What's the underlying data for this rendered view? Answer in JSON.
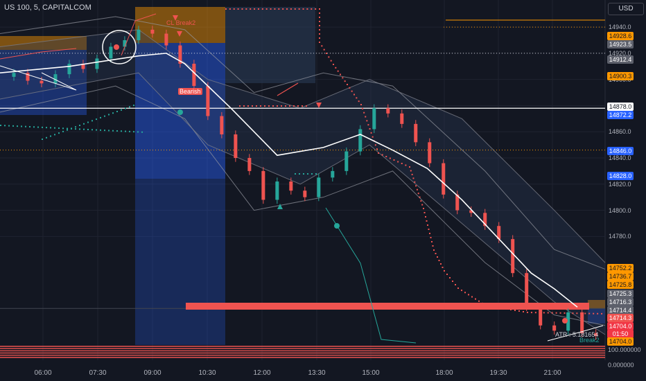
{
  "header": {
    "title": "US 100, 5, CAPITALCOM",
    "currency": "USD"
  },
  "colors": {
    "background": "#131722",
    "bull": "#26a69a",
    "bear": "#ef5350",
    "orange": "#ff9800",
    "blue": "#2962ff",
    "grey": "#b2b5be",
    "white": "#ffffff"
  },
  "chart_data": {
    "type": "candlestick",
    "symbol": "US 100, 5, CAPITALCOM",
    "currency": "USD",
    "x_ticks": [
      "06:00",
      "07:30",
      "09:00",
      "10:30",
      "12:00",
      "13:30",
      "15:00",
      "18:00",
      "19:30",
      "21:00"
    ],
    "y_ticks": [
      14940.0,
      14920.0,
      14900.0,
      14880.0,
      14860.0,
      14840.0,
      14820.0,
      14800.0,
      14780.0
    ],
    "y_range": [
      14696,
      14948
    ],
    "price_badges": [
      {
        "value": "14928.6",
        "kind": "orange"
      },
      {
        "value": "14923.5",
        "kind": "grey"
      },
      {
        "value": "14912.4",
        "kind": "grey"
      },
      {
        "value": "14900.3",
        "kind": "orange"
      },
      {
        "value": "14878.0",
        "kind": "white"
      },
      {
        "value": "14872.2",
        "kind": "blue"
      },
      {
        "value": "14846.0",
        "kind": "blue"
      },
      {
        "value": "14828.0",
        "kind": "blue"
      },
      {
        "value": "14752.2",
        "kind": "orange"
      },
      {
        "value": "14736.7",
        "kind": "orange"
      },
      {
        "value": "14725.8",
        "kind": "orange"
      },
      {
        "value": "14725.3",
        "kind": "grey"
      },
      {
        "value": "14716.3",
        "kind": "grey"
      },
      {
        "value": "14714.4",
        "kind": "grey"
      },
      {
        "value": "14714.3",
        "kind": "red"
      },
      {
        "value": "14704.0",
        "kind": "current"
      },
      {
        "value": "01:50",
        "kind": "current"
      },
      {
        "value": "14704.0",
        "kind": "orange"
      }
    ],
    "countdown": "01:50",
    "horizontal_levels": [
      14940.0,
      14920.0,
      14878.0,
      14846.0,
      14725.0
    ],
    "annotations": [
      "CL Break2",
      "Bearish",
      "ATR : 5.181654",
      "Break2"
    ],
    "atr_value": "ATR : 5.181654",
    "indicator_panel": {
      "ticks": [
        "100.000000",
        "0.000000"
      ]
    },
    "close_points": [
      [
        0,
        14902
      ],
      [
        6,
        14905
      ],
      [
        12,
        14899
      ],
      [
        18,
        14897
      ],
      [
        24,
        14904
      ],
      [
        30,
        14912
      ],
      [
        36,
        14908
      ],
      [
        42,
        14916
      ],
      [
        48,
        14925
      ],
      [
        54,
        14930
      ],
      [
        60,
        14938
      ],
      [
        66,
        14935
      ],
      [
        72,
        14926
      ],
      [
        78,
        14912
      ],
      [
        84,
        14895
      ],
      [
        90,
        14872
      ],
      [
        96,
        14858
      ],
      [
        102,
        14840
      ],
      [
        108,
        14830
      ],
      [
        114,
        14808
      ],
      [
        120,
        14822
      ],
      [
        126,
        14815
      ],
      [
        132,
        14810
      ],
      [
        138,
        14825
      ],
      [
        144,
        14830
      ],
      [
        150,
        14845
      ],
      [
        156,
        14862
      ],
      [
        162,
        14878
      ],
      [
        168,
        14874
      ],
      [
        174,
        14866
      ],
      [
        180,
        14852
      ],
      [
        186,
        14836
      ],
      [
        192,
        14812
      ],
      [
        198,
        14800
      ],
      [
        204,
        14798
      ],
      [
        210,
        14788
      ],
      [
        216,
        14778
      ],
      [
        222,
        14752
      ],
      [
        228,
        14726
      ],
      [
        234,
        14712
      ],
      [
        240,
        14708
      ],
      [
        246,
        14722
      ],
      [
        252,
        14706
      ],
      [
        258,
        14704
      ]
    ],
    "vwap_line": [
      [
        0,
        14905
      ],
      [
        30,
        14910
      ],
      [
        60,
        14918
      ],
      [
        72,
        14920
      ],
      [
        80,
        14912
      ],
      [
        100,
        14878
      ],
      [
        120,
        14842
      ],
      [
        140,
        14848
      ],
      [
        156,
        14858
      ],
      [
        170,
        14846
      ],
      [
        185,
        14832
      ],
      [
        200,
        14808
      ],
      [
        215,
        14780
      ],
      [
        230,
        14752
      ],
      [
        240,
        14740
      ],
      [
        250,
        14726
      ]
    ],
    "current_price": 14704.0
  }
}
